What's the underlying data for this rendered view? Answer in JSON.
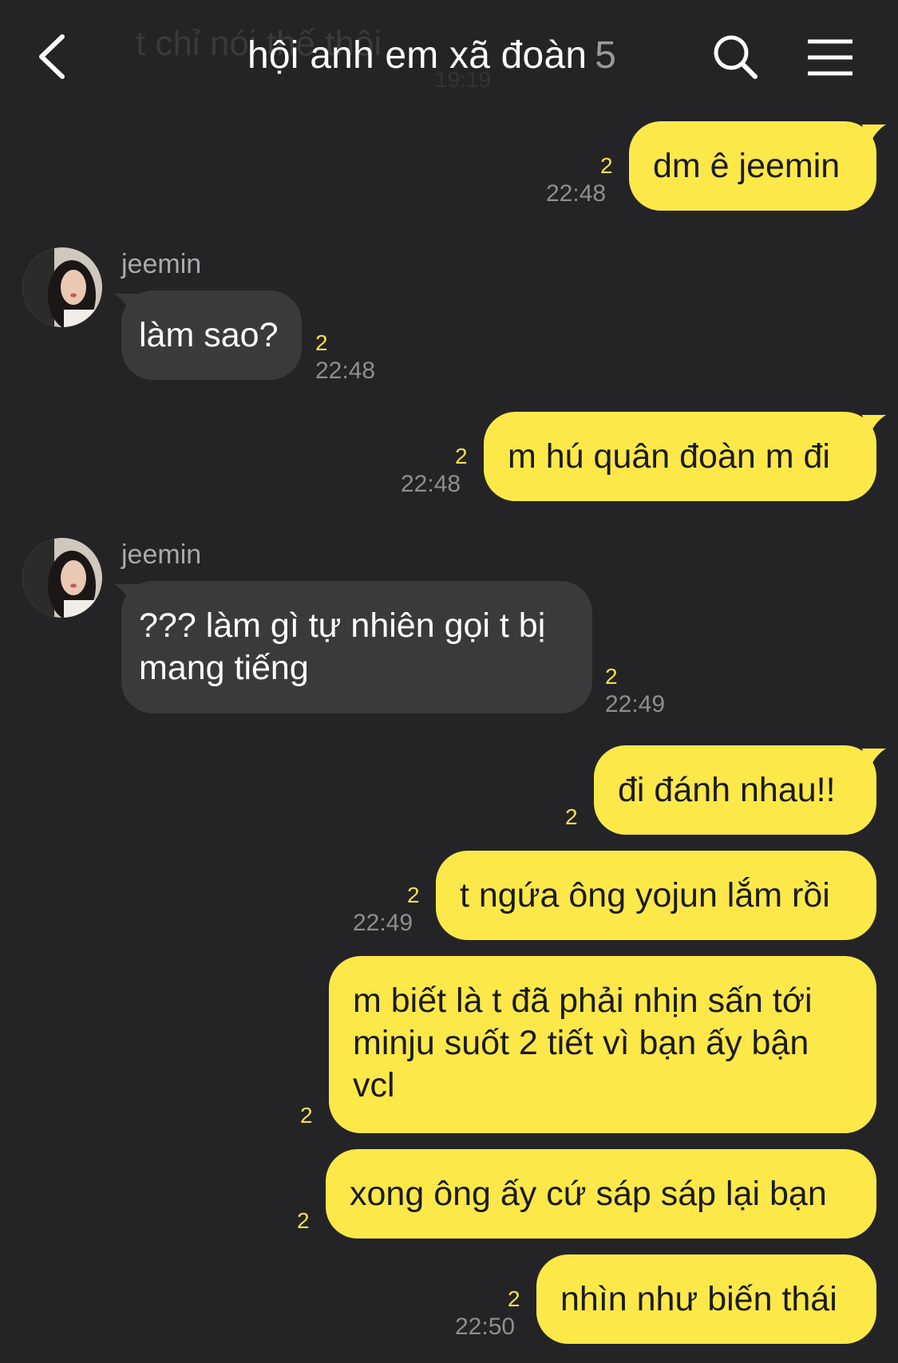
{
  "header": {
    "title": "hội anh em xã đoàn",
    "member_count": "5",
    "ghost_text": "t chỉ nói thế thôi",
    "ghost_time": "19:19"
  },
  "messages": [
    {
      "from": "me",
      "text": "dm ê jeemin",
      "read": "2",
      "time": "22:48"
    },
    {
      "from": "jeemin",
      "sender": "jeemin",
      "text": "làm sao?",
      "read": "2",
      "time": "22:48"
    },
    {
      "from": "me",
      "text": "m hú quân đoàn m đi",
      "read": "2",
      "time": "22:48"
    },
    {
      "from": "jeemin",
      "sender": "jeemin",
      "text_lines": [
        "??? làm gì tự nhiên gọi t bị",
        "mang tiếng"
      ],
      "read": "2",
      "time": "22:49"
    },
    {
      "from": "me",
      "text": "đi đánh nhau!!",
      "read": "2"
    },
    {
      "from": "me",
      "text": "t ngứa ông yojun lắm rồi",
      "read": "2",
      "time": "22:49"
    },
    {
      "from": "me",
      "text_lines": [
        "m biết là t đã phải nhịn sấn tới",
        "minju suốt 2 tiết vì bạn ấy bận",
        "vcl"
      ],
      "read": "2"
    },
    {
      "from": "me",
      "text": "xong ông ấy cứ sáp sáp lại bạn",
      "read": "2"
    },
    {
      "from": "me",
      "text": "nhìn như biến thái",
      "read": "2",
      "time": "22:50"
    }
  ],
  "colors": {
    "background": "#242427",
    "my_bubble": "#fde84a",
    "their_bubble": "#3a3a3d",
    "read_count": "#f4e04a"
  },
  "icons": [
    "chevron-left-icon",
    "search-icon",
    "hamburger-menu-icon"
  ]
}
